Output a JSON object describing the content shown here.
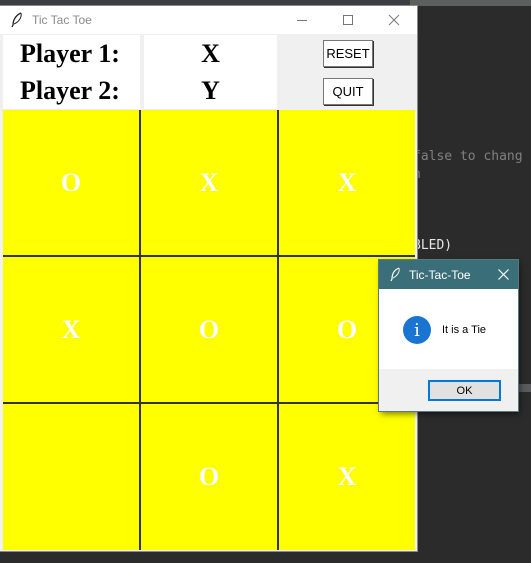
{
  "editor": {
    "lines": [
      {
        "text": "false to chang",
        "style": "gray"
      },
      {
        "text": "n",
        "style": "gray"
      },
      {
        "text": "BLED)",
        "style": "white"
      }
    ]
  },
  "window": {
    "title": "Tic Tac Toe",
    "controls": {
      "minimize": "minimize",
      "maximize": "maximize",
      "close": "close"
    }
  },
  "header": {
    "player1_label": "Player 1:",
    "player2_label": "Player 2:",
    "player1_mark": "X",
    "player2_mark": "Y",
    "reset_label": "RESET",
    "quit_label": "QUIT"
  },
  "board": {
    "cells": [
      [
        "O",
        "X",
        "X"
      ],
      [
        "X",
        "O",
        "O"
      ],
      [
        "",
        "O",
        "X"
      ]
    ],
    "cell_color": "#ffff00",
    "mark_color": "#ffffff"
  },
  "dialog": {
    "title": "Tic-Tac-Toe",
    "message": "It is a Tie",
    "ok_label": "OK",
    "icon": "info-icon",
    "title_color": "#3a6e78"
  }
}
